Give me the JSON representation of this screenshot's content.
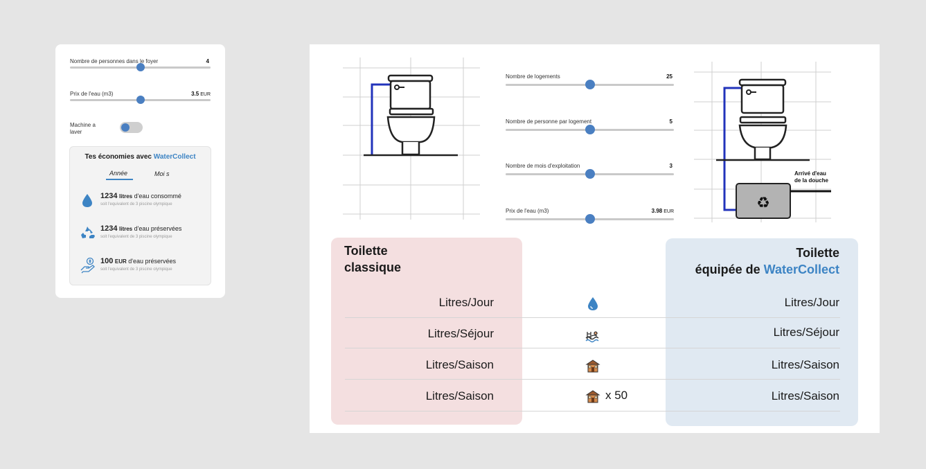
{
  "left_card": {
    "sliders": [
      {
        "label": "Nombre de personnes dans le foyer",
        "value": "4",
        "unit": "",
        "position": 0.5
      },
      {
        "label": "Prix de l'eau (m3)",
        "value": "3.5",
        "unit": "EUR",
        "position": 0.5
      }
    ],
    "toggle": {
      "label": "Machine a laver",
      "on": false
    },
    "savings": {
      "title_prefix": "Tes économies avec ",
      "title_brand": "WaterCollect",
      "tabs": [
        "Année",
        "Moi s"
      ],
      "active_tab": "Année",
      "rows": [
        {
          "icon": "water-drop-icon",
          "amount": "1234",
          "unit": "litres",
          "text": " d'eau consommé",
          "sub": "soit l'equivalent de 3 piscine olympique"
        },
        {
          "icon": "recycle-icon",
          "amount": "1234",
          "unit": "litres",
          "text": " d'eau préservées",
          "sub": "soit l'equivalent de 3 piscine olympique"
        },
        {
          "icon": "money-hand-icon",
          "amount": "100",
          "unit": "EUR",
          "text": " d'eau préservées",
          "sub": "soit l'equivalent de 3 piscine olympique"
        }
      ]
    }
  },
  "right_panel": {
    "sliders": [
      {
        "label": "Nombre de logements",
        "value": "25",
        "unit": "",
        "position": 0.5
      },
      {
        "label": "Nombre de personne par logement",
        "value": "5",
        "unit": "",
        "position": 0.5
      },
      {
        "label": "Nombre de mois d'exploitation",
        "value": "3",
        "unit": "",
        "position": 0.5
      },
      {
        "label": "Prix de l'eau (m3)",
        "value": "3.98",
        "unit": "EUR",
        "position": 0.5
      }
    ],
    "diagram_label": "Arrivé d'eau de la douche",
    "classic_title": "Toilette classique",
    "wc_title_line1": "Toilette",
    "wc_title_prefix": "équipée de ",
    "wc_title_brand": "WaterCollect",
    "rows": [
      {
        "left": "Litres/Jour",
        "icon": "water-drop-icon",
        "mid_text": "",
        "right": "Litres/Jour"
      },
      {
        "left": "Litres/Séjour",
        "icon": "pool-icon",
        "mid_text": "",
        "right": "Litres/Séjour"
      },
      {
        "left": "Litres/Saison",
        "icon": "house-icon",
        "mid_text": "",
        "right": "Litres/Saison"
      },
      {
        "left": "Litres/Saison",
        "icon": "house-icon",
        "mid_text": "x 50",
        "right": "Litres/Saison"
      }
    ]
  },
  "colors": {
    "accent": "#4a7fc1",
    "brand": "#3d84c4",
    "classic_bg": "#f4dfe0",
    "watercollect_bg": "#e0e9f2",
    "pipe": "#2233bb"
  }
}
